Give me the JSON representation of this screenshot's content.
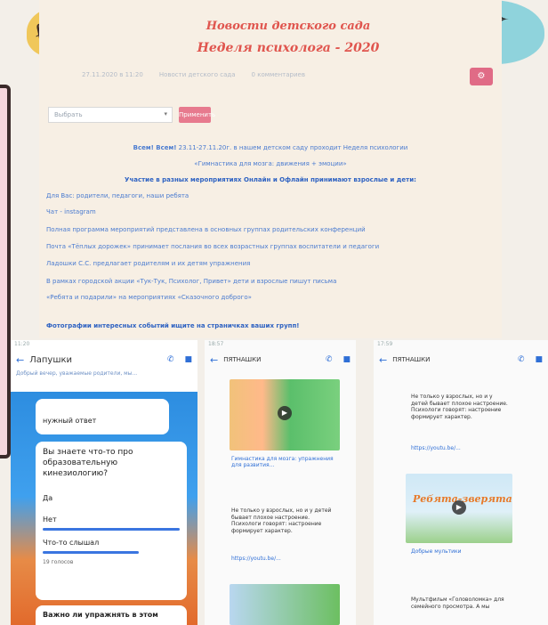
{
  "site": {
    "title_line1": "Новости детского сада",
    "title_line2": "Неделя психолога - 2020",
    "meta": [
      "27.11.2020 в 11:20",
      "Новости детского сада",
      "0 комментариев"
    ],
    "filter": {
      "placeholder": "Выбрать",
      "apply": "Применить"
    }
  },
  "article": {
    "line1_bold": "Всем! Всем!",
    "line1_rest": " 23.11-27.11.20г. в нашем детском саду проходит Неделя психологии",
    "line2": "«Гимнастика для мозга: движения + эмоции»",
    "line3": "Участие в разных мероприятиях Онлайн и Офлайн принимают взрослые и дети:",
    "list": [
      "Для Вас: родители, педагоги, наши ребята",
      "Чат - instagram",
      "Полная программа мероприятий представлена в основных группах родительских конференций",
      "Почта «Тёплых дорожек» принимает послания во всех возрастных группах воспитатели и педагоги",
      "Ладошки С.С. предлагает родителям и их детям упражнения",
      "В рамках городской акции «Тук-Тук, Психолог, Привет» дети и взрослые пишут письма",
      "«Ребята и подарили» на мероприятиях «Сказочного доброго»"
    ],
    "footer": "Фотографии интересных событий ищите на страничках ваших групп!"
  },
  "phone1": {
    "status": "11:20",
    "chat_name": "Лапушки",
    "sub": "Добрый вечер, уважаемые родители, мы...",
    "reply_snip": "нужный ответ",
    "question": "Вы знаете что-то про образовательную кинезиологию?",
    "options": [
      "Да",
      "Нет",
      "Что-то слышал"
    ],
    "votes": "19 голосов",
    "next": "Важно ли упражнять в этом"
  },
  "phone2": {
    "status": "18:57",
    "chat_name": "ПЯТНАШКИ",
    "link1": "Гимнастика для мозга: упражнения для развития...",
    "text1": "Не только у взрослых, но и у детей бывает плохое настроение. Психологи говорят: настроение формирует характер.",
    "link2": "https://youtu.be/..."
  },
  "phone3": {
    "status": "17:59",
    "chat_name": "ПЯТНАШКИ",
    "text1": "Не только у взрослых, но и у детей бывает плохое настроение. Психологи говорят: настроение формирует характер.",
    "link1": "https://youtu.be/...",
    "video_title": "Ребята-зверята",
    "link2": "Добрые мультики",
    "text2": "Мультфильм «Головоломка» для семейного просмотра. А мы"
  }
}
